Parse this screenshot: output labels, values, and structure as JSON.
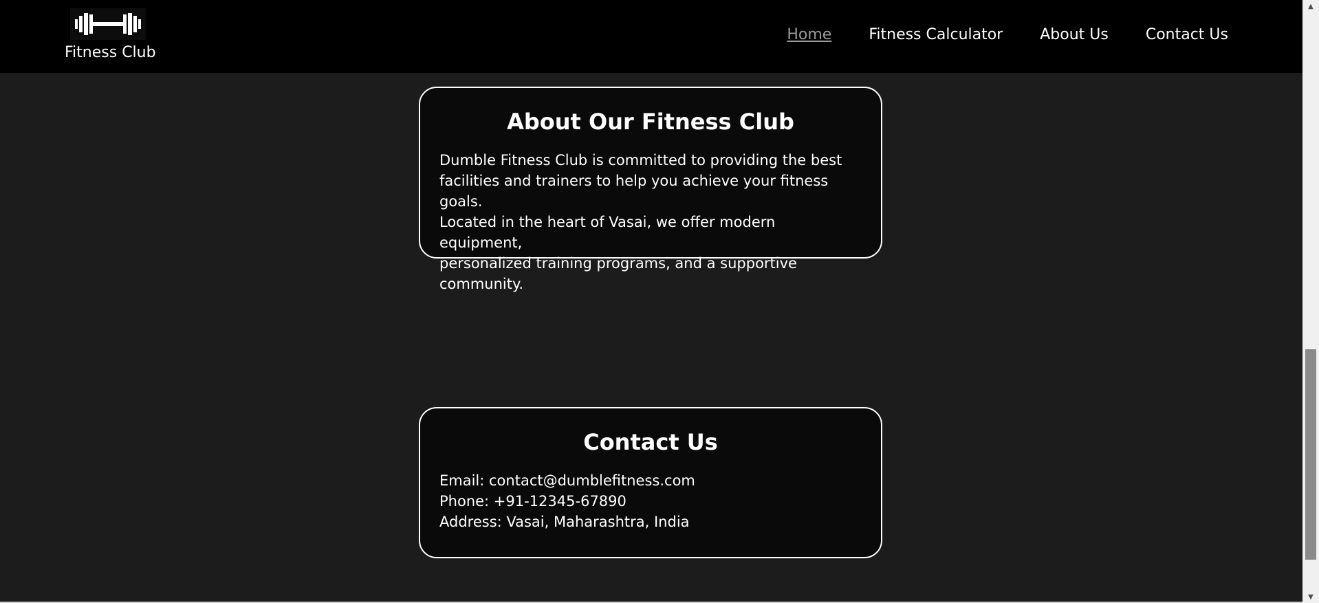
{
  "nav": {
    "brand": "Fitness Club",
    "logo_icon": "dumbbell-icon",
    "links": [
      {
        "label": "Home",
        "active": true
      },
      {
        "label": "Fitness Calculator",
        "active": false
      },
      {
        "label": "About Us",
        "active": false
      },
      {
        "label": "Contact Us",
        "active": false
      }
    ]
  },
  "about": {
    "title": "About Our Fitness Club",
    "lines": [
      "Dumble Fitness Club is committed to providing the best",
      "facilities and trainers to help you achieve your fitness goals.",
      "Located in the heart of Vasai, we offer modern equipment,",
      "personalized training programs, and a supportive community."
    ]
  },
  "contact": {
    "title": "Contact Us",
    "email": "Email: contact@dumblefitness.com",
    "phone": "Phone: +91-12345-67890",
    "address": "Address: Vasai, Maharashtra, India"
  },
  "colors": {
    "page_bg": "#1c1c1c",
    "nav_bg": "#000000",
    "card_bg": "#0a0a0a",
    "text": "#ffffff",
    "active_link": "#9a9a9a"
  }
}
